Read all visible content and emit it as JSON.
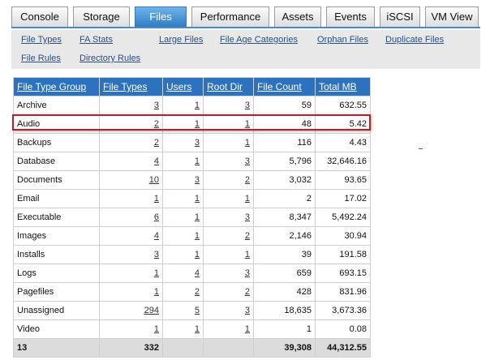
{
  "tabs": [
    {
      "label": "Console",
      "active": false
    },
    {
      "label": "Storage",
      "active": false
    },
    {
      "label": "Files",
      "active": true
    },
    {
      "label": "Performance",
      "active": false
    },
    {
      "label": "Assets",
      "active": false
    },
    {
      "label": "Events",
      "active": false
    },
    {
      "label": "iSCSI",
      "active": false
    },
    {
      "label": "VM View",
      "active": false
    }
  ],
  "subnav": [
    "File Types",
    "FA Stats",
    "Large Files",
    "File Age Categories",
    "Orphan Files",
    "Duplicate Files",
    "File Rules",
    "Directory Rules"
  ],
  "table": {
    "headers": [
      "File Type Group",
      "File Types",
      "Users",
      "Root Dir",
      "File Count",
      "Total MB"
    ],
    "rows": [
      [
        "Archive",
        "3",
        "1",
        "3",
        "59",
        "632.55"
      ],
      [
        "Audio",
        "2",
        "1",
        "1",
        "48",
        "5.42"
      ],
      [
        "Backups",
        "2",
        "3",
        "1",
        "116",
        "4.43"
      ],
      [
        "Database",
        "4",
        "1",
        "3",
        "5,796",
        "32,646.16"
      ],
      [
        "Documents",
        "10",
        "3",
        "2",
        "3,032",
        "93.65"
      ],
      [
        "Email",
        "1",
        "1",
        "1",
        "2",
        "17.02"
      ],
      [
        "Executable",
        "6",
        "1",
        "3",
        "8,347",
        "5,492.24"
      ],
      [
        "Images",
        "4",
        "1",
        "2",
        "2,146",
        "30.94"
      ],
      [
        "Installs",
        "3",
        "1",
        "1",
        "39",
        "191.58"
      ],
      [
        "Logs",
        "1",
        "4",
        "3",
        "659",
        "693.15"
      ],
      [
        "Pagefiles",
        "1",
        "2",
        "2",
        "428",
        "831.96"
      ],
      [
        "Unassigned",
        "294",
        "5",
        "3",
        "18,635",
        "3,673.36"
      ],
      [
        "Video",
        "1",
        "1",
        "1",
        "1",
        "0.08"
      ]
    ],
    "totals": [
      "13",
      "332",
      "",
      "",
      "39,308",
      "44,312.55"
    ]
  },
  "highlighted_row": "Audio",
  "colors": {
    "accent": "#2c72bf",
    "highlight": "#b5202a"
  }
}
